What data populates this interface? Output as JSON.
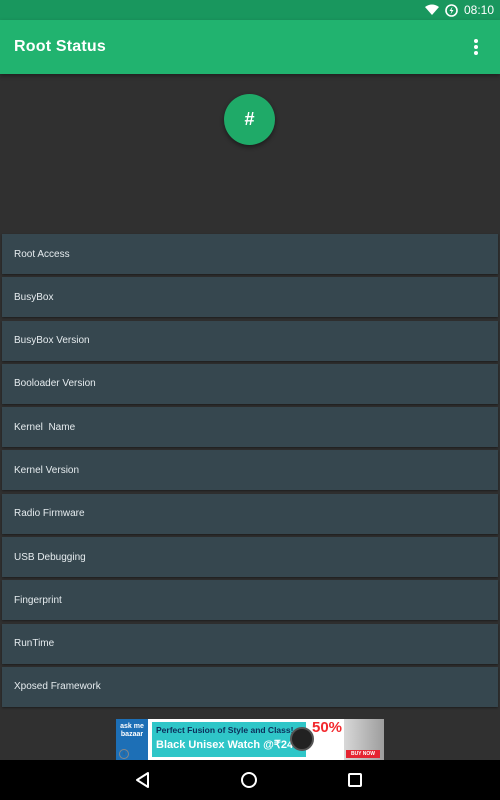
{
  "status_bar": {
    "time": "08:10"
  },
  "app_bar": {
    "title": "Root Status",
    "overflow_icon": "more-vert-icon"
  },
  "hero": {
    "badge_symbol": "#"
  },
  "list": {
    "items": [
      "Root Access",
      "BusyBox",
      "BusyBox Version",
      "Booloader Version",
      "Kernel  Name",
      "Kernel Version",
      "Radio Firmware",
      "USB Debugging",
      "Fingerprint",
      "RunTime",
      "Xposed Framework"
    ]
  },
  "ad": {
    "logo_text": "ask me bazaar",
    "line1": "Perfect Fusion of Style and Class!",
    "line2": "Black Unisex Watch @₹249",
    "discount": "50%",
    "cta": "BUY NOW"
  },
  "colors": {
    "status_bar": "#19975e",
    "app_bar": "#21b36f",
    "background": "#303030",
    "list_row": "#36474f"
  }
}
